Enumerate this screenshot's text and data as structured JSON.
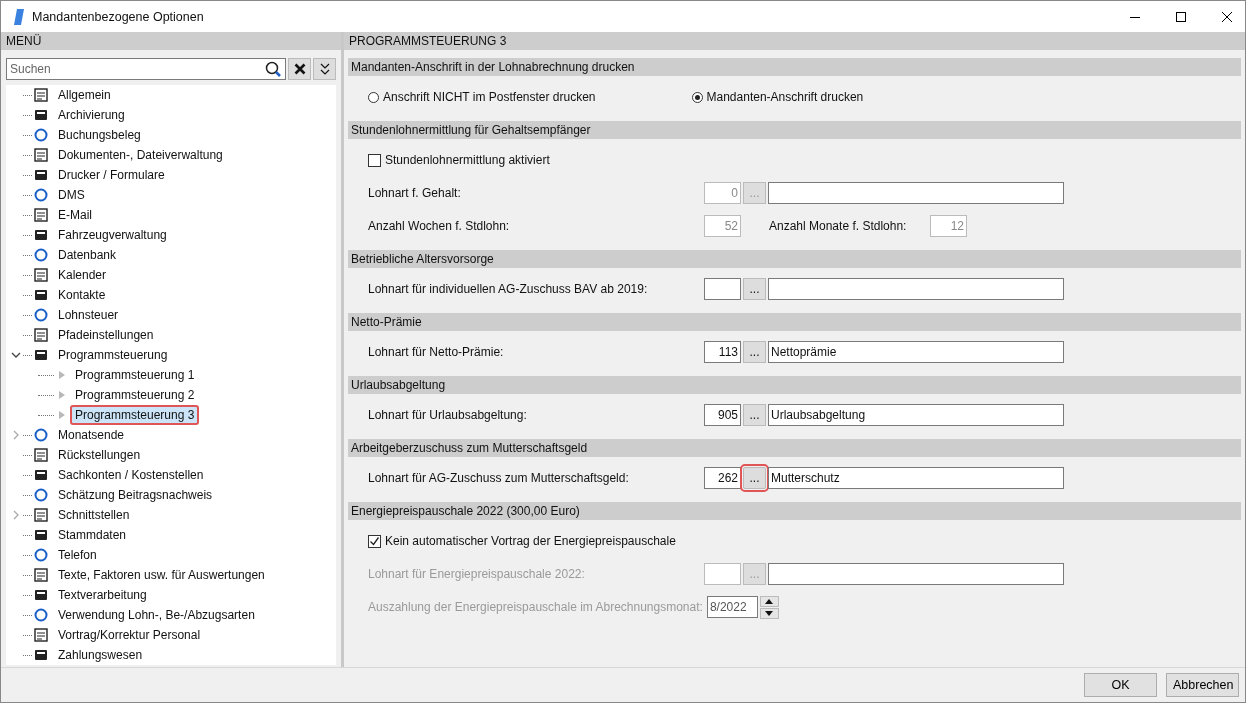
{
  "window": {
    "title": "Mandantenbezogene Optionen"
  },
  "menu": {
    "title": "MENÜ",
    "search": {
      "placeholder": "Suchen"
    },
    "tree": [
      {
        "label": "Allgemein",
        "selected": false
      },
      {
        "label": "Archivierung",
        "selected": false
      },
      {
        "label": "Buchungsbeleg",
        "selected": false
      },
      {
        "label": "Dokumenten-, Dateiverwaltung",
        "selected": false
      },
      {
        "label": "Drucker / Formulare",
        "selected": false
      },
      {
        "label": "DMS",
        "selected": false
      },
      {
        "label": "E-Mail",
        "selected": false
      },
      {
        "label": "Fahrzeugverwaltung",
        "selected": false
      },
      {
        "label": "Datenbank",
        "selected": false
      },
      {
        "label": "Kalender",
        "selected": false
      },
      {
        "label": "Kontakte",
        "selected": false
      },
      {
        "label": "Lohnsteuer",
        "selected": false
      },
      {
        "label": "Pfadeinstellungen",
        "selected": false
      },
      {
        "label": "Programmsteuerung",
        "selected": false,
        "expanded": true,
        "children": [
          {
            "label": "Programmsteuerung 1",
            "selected": false
          },
          {
            "label": "Programmsteuerung 2",
            "selected": false
          },
          {
            "label": "Programmsteuerung 3",
            "selected": true
          }
        ]
      },
      {
        "label": "Monatsende",
        "selected": false,
        "expanded": false
      },
      {
        "label": "Rückstellungen",
        "selected": false
      },
      {
        "label": "Sachkonten / Kostenstellen",
        "selected": false
      },
      {
        "label": "Schätzung Beitragsnachweis",
        "selected": false
      },
      {
        "label": "Schnittstellen",
        "selected": false,
        "expanded": false
      },
      {
        "label": "Stammdaten",
        "selected": false
      },
      {
        "label": "Telefon",
        "selected": false
      },
      {
        "label": "Texte, Faktoren usw. für Auswertungen",
        "selected": false
      },
      {
        "label": "Textverarbeitung",
        "selected": false
      },
      {
        "label": "Verwendung Lohn-, Be-/Abzugsarten",
        "selected": false
      },
      {
        "label": "Vortrag/Korrektur Personal",
        "selected": false
      },
      {
        "label": "Zahlungswesen",
        "selected": false
      }
    ]
  },
  "content": {
    "title": "PROGRAMMSTEUERUNG 3",
    "sections": [
      {
        "title": "Mandanten-Anschrift in der Lohnabrechnung drucken",
        "rows": [
          {
            "kind": "radios",
            "options": [
              {
                "label": "Anschrift NICHT im Postfenster drucken",
                "selected": false
              },
              {
                "label": "Mandanten-Anschrift drucken",
                "selected": true
              }
            ]
          }
        ]
      },
      {
        "title": "Stundenlohnermittlung für Gehaltsempfänger",
        "rows": [
          {
            "kind": "checkbox",
            "label": "Stundenlohnermittlung aktiviert",
            "checked": false
          },
          {
            "kind": "lookup",
            "label": "Lohnart f. Gehalt:",
            "code": "0",
            "button": "...",
            "disabled": true,
            "dimmed": false,
            "highlighted": false
          },
          {
            "kind": "pair",
            "label": "Anzahl Wochen f. Stdlohn:",
            "value": "52",
            "label2": "Anzahl Monate f. Stdlohn:",
            "value2": "12",
            "disabled": true
          }
        ]
      },
      {
        "title": "Betriebliche Altersvorsorge",
        "rows": [
          {
            "kind": "lookup",
            "label": "Lohnart für individuellen AG-Zuschuss BAV ab 2019:",
            "button": "...",
            "disabled": false,
            "dimmed": false,
            "highlighted": false
          }
        ]
      },
      {
        "title": "Netto-Prämie",
        "rows": [
          {
            "kind": "lookup",
            "label": "Lohnart für Netto-Prämie:",
            "code": "113",
            "button": "...",
            "name": "Nettoprämie",
            "disabled": false,
            "dimmed": false,
            "highlighted": false
          }
        ]
      },
      {
        "title": "Urlaubsabgeltung",
        "rows": [
          {
            "kind": "lookup",
            "label": "Lohnart für Urlaubsabgeltung:",
            "code": "905",
            "button": "...",
            "name": "Urlaubsabgeltung",
            "disabled": false,
            "dimmed": false,
            "highlighted": false
          }
        ]
      },
      {
        "title": "Arbeitgeberzuschuss zum Mutterschaftsgeld",
        "rows": [
          {
            "kind": "lookup",
            "label": "Lohnart für AG-Zuschuss zum Mutterschaftsgeld:",
            "code": "262",
            "button": "...",
            "name": "Mutterschutz",
            "disabled": false,
            "dimmed": false,
            "highlighted": true
          }
        ]
      },
      {
        "title": "Energiepreispauschale 2022 (300,00 Euro)",
        "rows": [
          {
            "kind": "checkbox",
            "label": "Kein automatischer Vortrag der Energiepreispauschale",
            "checked": true
          },
          {
            "kind": "lookup",
            "label": "Lohnart für Energiepreispauschale 2022:",
            "button": "...",
            "disabled": true,
            "dimmed": true,
            "highlighted": false
          },
          {
            "kind": "spinner",
            "label": "Auszahlung der Energiepreispauschale im Abrechnungsmonat:",
            "value": "8/2022",
            "dimmed": true
          }
        ]
      }
    ]
  },
  "buttons": [
    {
      "label": "OK"
    },
    {
      "label": "Abbrechen"
    }
  ]
}
